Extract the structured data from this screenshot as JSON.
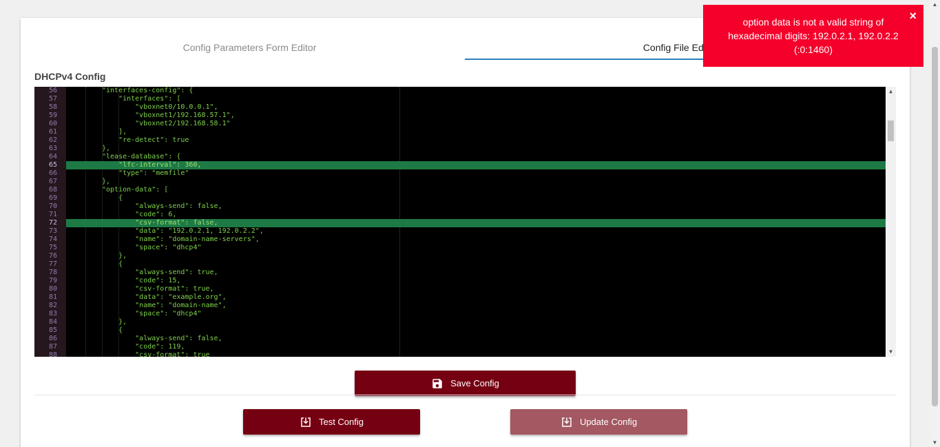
{
  "tabs": [
    {
      "label": "Config Parameters Form Editor"
    },
    {
      "label": "Config File Editor"
    }
  ],
  "section_title": "DHCPv4 Config",
  "code_lines": [
    {
      "n": "56",
      "t": "\"interfaces-config\": {"
    },
    {
      "n": "57",
      "t": "    \"interfaces\": ["
    },
    {
      "n": "58",
      "t": "        \"vboxnet0/10.0.0.1\","
    },
    {
      "n": "59",
      "t": "        \"vboxnet1/192.168.57.1\","
    },
    {
      "n": "60",
      "t": "        \"vboxnet2/192.168.58.1\""
    },
    {
      "n": "61",
      "t": "    ],"
    },
    {
      "n": "62",
      "t": "    \"re-detect\": true"
    },
    {
      "n": "63",
      "t": "},"
    },
    {
      "n": "64",
      "t": "\"lease-database\": {"
    },
    {
      "n": "65",
      "t": "    \"lfc-interval\": 360,"
    },
    {
      "n": "66",
      "t": "    \"type\": \"memfile\""
    },
    {
      "n": "67",
      "t": "},"
    },
    {
      "n": "68",
      "t": "\"option-data\": ["
    },
    {
      "n": "69",
      "t": "    {"
    },
    {
      "n": "70",
      "t": "        \"always-send\": false,"
    },
    {
      "n": "71",
      "t": "        \"code\": 6,"
    },
    {
      "n": "72",
      "t": "        \"csv-format\": false,"
    },
    {
      "n": "73",
      "t": "        \"data\": \"192.0.2.1, 192.0.2.2\","
    },
    {
      "n": "74",
      "t": "        \"name\": \"domain-name-servers\","
    },
    {
      "n": "75",
      "t": "        \"space\": \"dhcp4\""
    },
    {
      "n": "76",
      "t": "    },"
    },
    {
      "n": "77",
      "t": "    {"
    },
    {
      "n": "78",
      "t": "        \"always-send\": true,"
    },
    {
      "n": "79",
      "t": "        \"code\": 15,"
    },
    {
      "n": "80",
      "t": "        \"csv-format\": true,"
    },
    {
      "n": "81",
      "t": "        \"data\": \"example.org\","
    },
    {
      "n": "82",
      "t": "        \"name\": \"domain-name\","
    },
    {
      "n": "83",
      "t": "        \"space\": \"dhcp4\""
    },
    {
      "n": "84",
      "t": "    },"
    },
    {
      "n": "85",
      "t": "    {"
    },
    {
      "n": "86",
      "t": "        \"always-send\": false,"
    },
    {
      "n": "87",
      "t": "        \"code\": 119,"
    },
    {
      "n": "88",
      "t": "        \"csv-format\": true"
    }
  ],
  "highlighted_lines": [
    "65",
    "72"
  ],
  "buttons": {
    "save": "Save Config",
    "test": "Test Config",
    "update": "Update Config"
  },
  "toast": {
    "message": "option data is not a valid string of hexadecimal digits: 192.0.2.1, 192.0.2.2 (:0:1460)",
    "close": "×"
  },
  "colors": {
    "accent": "#750012",
    "toast": "#f5002a",
    "highlight": "#1e7a45",
    "code_text": "#7fd14b"
  }
}
